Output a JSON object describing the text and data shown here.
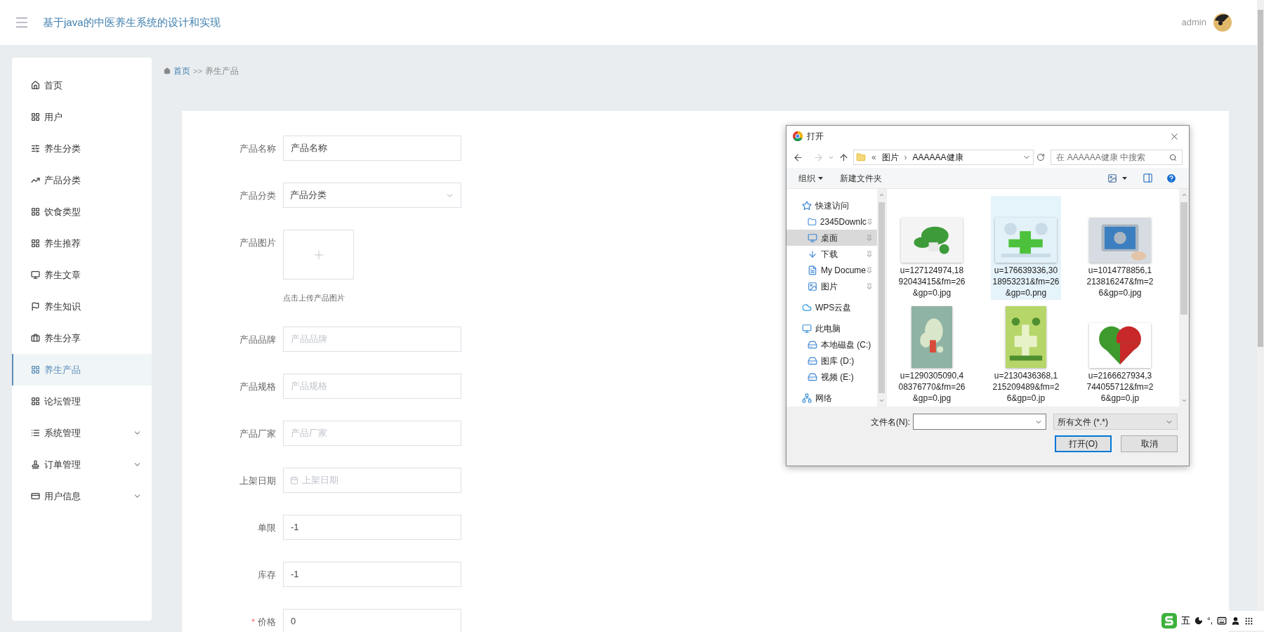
{
  "header": {
    "title": "基于java的中医养生系统的设计和实现",
    "user": "admin"
  },
  "sidebar": {
    "items": [
      {
        "label": "首页",
        "kind": "link",
        "selected": false
      },
      {
        "label": "用户",
        "kind": "link",
        "selected": false
      },
      {
        "label": "养生分类",
        "kind": "link",
        "selected": false
      },
      {
        "label": "产品分类",
        "kind": "link",
        "selected": false
      },
      {
        "label": "饮食类型",
        "kind": "link",
        "selected": false
      },
      {
        "label": "养生推荐",
        "kind": "link",
        "selected": false
      },
      {
        "label": "养生文章",
        "kind": "link",
        "selected": false
      },
      {
        "label": "养生知识",
        "kind": "link",
        "selected": false
      },
      {
        "label": "养生分享",
        "kind": "link",
        "selected": false
      },
      {
        "label": "养生产品",
        "kind": "link",
        "selected": true
      },
      {
        "label": "论坛管理",
        "kind": "link",
        "selected": false
      },
      {
        "label": "系统管理",
        "kind": "group",
        "selected": false
      },
      {
        "label": "订单管理",
        "kind": "group",
        "selected": false
      },
      {
        "label": "用户信息",
        "kind": "group",
        "selected": false
      }
    ]
  },
  "breadcrumb": {
    "home": "首页",
    "separator": ">>",
    "current": "养生产品"
  },
  "form": {
    "required_mark": "*",
    "fields": [
      {
        "label": "产品名称",
        "kind": "text",
        "value": "产品名称",
        "required": false
      },
      {
        "label": "产品分类",
        "kind": "select",
        "value": "产品分类",
        "required": false
      },
      {
        "label": "产品图片",
        "kind": "upload",
        "hint": "点击上传产品图片",
        "required": false
      },
      {
        "label": "产品品牌",
        "kind": "text",
        "placeholder": "产品品牌",
        "required": false
      },
      {
        "label": "产品规格",
        "kind": "text",
        "placeholder": "产品规格",
        "required": false
      },
      {
        "label": "产品厂家",
        "kind": "text",
        "placeholder": "产品厂家",
        "required": false
      },
      {
        "label": "上架日期",
        "kind": "date",
        "placeholder": "上架日期",
        "required": false
      },
      {
        "label": "单限",
        "kind": "text",
        "value": "-1",
        "required": false
      },
      {
        "label": "库存",
        "kind": "text",
        "value": "-1",
        "required": false
      },
      {
        "label": "价格",
        "kind": "text",
        "value": "0",
        "required": true
      }
    ]
  },
  "dialog": {
    "title": "打开",
    "path_prefix": "«",
    "path": [
      "图片",
      "AAAAAA健康"
    ],
    "path_separator": "›",
    "search_placeholder": "在 AAAAAA健康 中搜索",
    "toolbar": [
      "组织",
      "新建文件夹"
    ],
    "nav": [
      {
        "label": "快速访问",
        "selected": false,
        "children": [
          {
            "label": "2345Downlc",
            "selected": false,
            "pinned": true
          },
          {
            "label": "桌面",
            "selected": true,
            "pinned": true
          },
          {
            "label": "下载",
            "selected": false,
            "pinned": true
          },
          {
            "label": "My Docume",
            "selected": false,
            "pinned": true
          },
          {
            "label": "图片",
            "selected": false,
            "pinned": true
          }
        ]
      },
      {
        "label": "WPS云盘",
        "selected": false
      },
      {
        "label": "此电脑",
        "selected": false,
        "children": [
          {
            "label": "本地磁盘 (C:)",
            "selected": false
          },
          {
            "label": "图库 (D:)",
            "selected": false
          },
          {
            "label": "视频 (E:)",
            "selected": false
          }
        ]
      },
      {
        "label": "网络",
        "selected": false
      }
    ],
    "files": [
      {
        "name": "u=127124974,1892043415&fm=26&gp=0.jpg",
        "selected": false
      },
      {
        "name": "u=176639336,3018953231&fm=26&gp=0.png",
        "selected": true
      },
      {
        "name": "u=1014778856,1213816247&fm=26&gp=0.jpg",
        "selected": false
      },
      {
        "name": "u=1290305090,408376770&fm=26&gp=0.jpg",
        "selected": false
      },
      {
        "name": "u=2130436368,1215209489&fm=26&gp=0.jp",
        "selected": false
      },
      {
        "name": "u=2166627934,3744055712&fm=26&gp=0.jp",
        "selected": false
      }
    ],
    "file_name_label": "文件名(N):",
    "file_type": "所有文件 (*.*)",
    "buttons": [
      {
        "label": "打开(O)",
        "default": true
      },
      {
        "label": "取消",
        "default": false
      }
    ]
  },
  "ime": {
    "chars": [
      "五",
      "°,"
    ]
  }
}
